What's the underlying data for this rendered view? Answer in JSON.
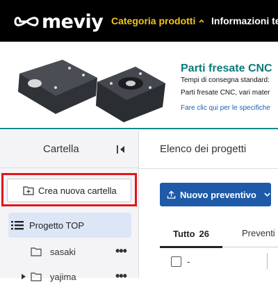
{
  "topbar": {
    "logo_text": "meviy",
    "nav_categoria": "Categoria prodotti",
    "nav_info": "Informazioni tec"
  },
  "banner": {
    "title": "Parti fresate CNC",
    "line1": "Tempi di consegna standard:",
    "line2": "Parti fresate CNC, vari mater",
    "link": "Fare clic qui per le specifiche"
  },
  "sidebar": {
    "title": "Cartella",
    "new_folder_label": "Crea nuova cartella",
    "tree": {
      "top_label": "Progetto TOP",
      "items": [
        {
          "label": "sasaki"
        },
        {
          "label": "yajima"
        }
      ]
    }
  },
  "main": {
    "title": "Elenco dei progetti",
    "new_quote_label": "Nuovo preventivo",
    "tabs": {
      "all_label": "Tutto",
      "all_count": "26",
      "quotes_label": "Preventi"
    },
    "row_placeholder": "-"
  },
  "colors": {
    "accent_yellow": "#f5c518",
    "primary_blue": "#1e5aa8",
    "teal": "#0b7a7a",
    "highlight_red": "#e0161b"
  }
}
